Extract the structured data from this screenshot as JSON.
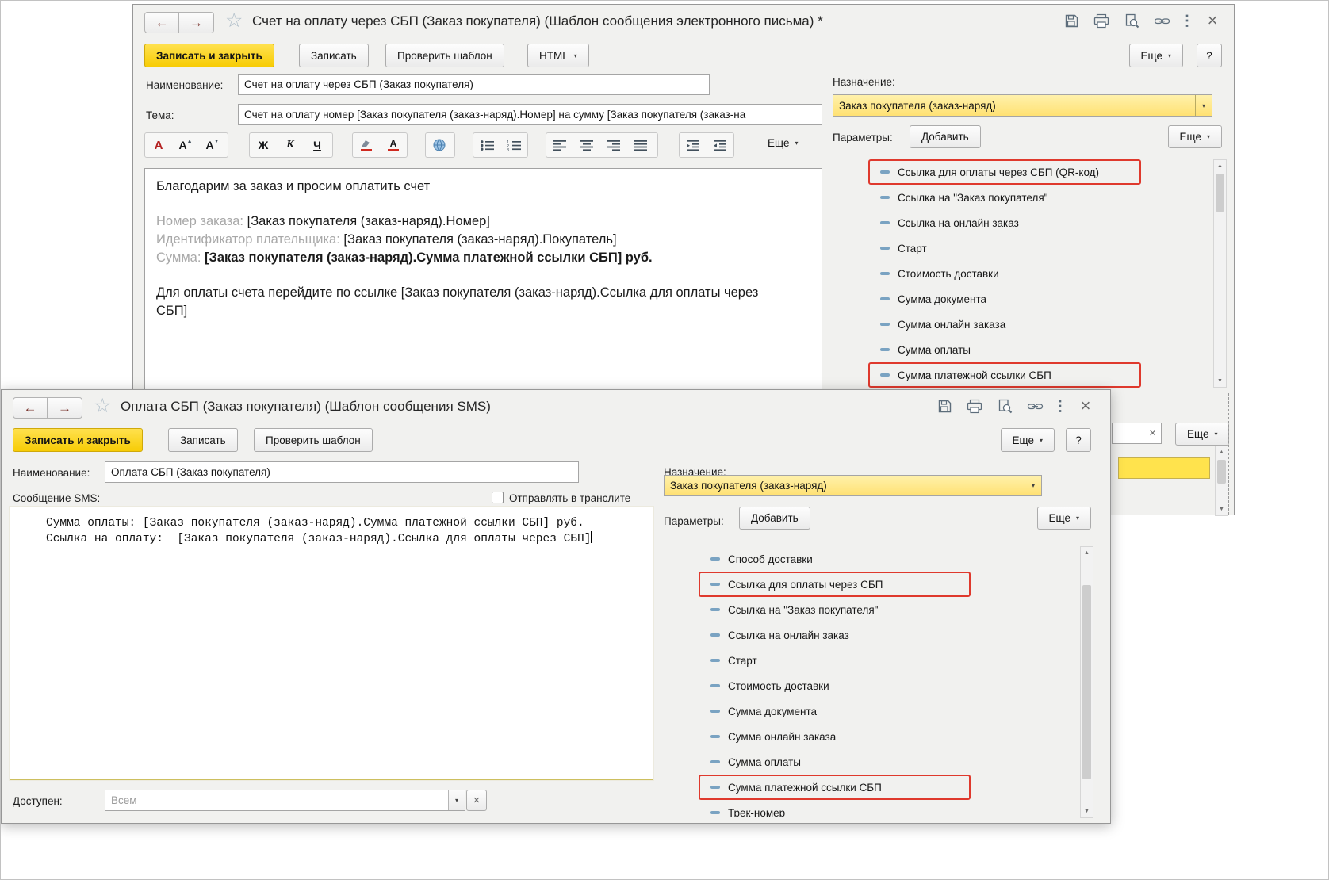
{
  "icons": {
    "back": "←",
    "forward": "→",
    "star": "☆",
    "kebab": "⋮",
    "close": "×",
    "caret": "▾",
    "up": "▲",
    "down": "▼",
    "font_a": "А",
    "clear": "×",
    "help": "?"
  },
  "email_window": {
    "title": "Счет на оплату через СБП (Заказ покупателя) (Шаблон сообщения электронного письма) *",
    "commands": {
      "save_close": "Записать и закрыть",
      "save": "Записать",
      "check": "Проверить шаблон",
      "html": "HTML",
      "more": "Еще",
      "help": "?"
    },
    "name_label": "Наименование:",
    "name_value": "Счет на оплату через СБП (Заказ покупателя)",
    "subject_label": "Тема:",
    "subject_value": "Счет на оплату номер [Заказ покупателя (заказ-наряд).Номер] на сумму [Заказ покупателя (заказ-на",
    "format_toolbar": {
      "bold": "Ж",
      "italic": "К",
      "underline": "Ч",
      "more": "Еще"
    },
    "body": {
      "greeting": "Благодарим за заказ и просим оплатить счет",
      "order_label": "Номер заказа:",
      "order_value": "[Заказ покупателя (заказ-наряд).Номер]",
      "payer_label": "Идентификатор плательщика:",
      "payer_value": "[Заказ покупателя (заказ-наряд).Покупатель]",
      "amount_label": "Сумма:",
      "amount_value": "[Заказ покупателя (заказ-наряд).Сумма платежной ссылки СБП] руб.",
      "pay_link_text": "Для оплаты счета перейдите по ссылке [Заказ покупателя (заказ-наряд).Ссылка для оплаты через СБП]"
    },
    "purpose_label": "Назначение:",
    "purpose_value": "Заказ покупателя (заказ-наряд)",
    "params_label": "Параметры:",
    "add_button": "Добавить",
    "params_more": "Еще",
    "footer_more": "Еще",
    "params": [
      {
        "label": "Ссылка для оплаты через СБП (QR-код)",
        "highlighted": true
      },
      {
        "label": "Ссылка на \"Заказ покупателя\"",
        "highlighted": false
      },
      {
        "label": "Ссылка на онлайн заказ",
        "highlighted": false
      },
      {
        "label": "Старт",
        "highlighted": false
      },
      {
        "label": "Стоимость доставки",
        "highlighted": false
      },
      {
        "label": "Сумма документа",
        "highlighted": false
      },
      {
        "label": "Сумма онлайн заказа",
        "highlighted": false
      },
      {
        "label": "Сумма оплаты",
        "highlighted": false
      },
      {
        "label": "Сумма платежной ссылки СБП",
        "highlighted": true
      }
    ]
  },
  "sms_window": {
    "title": "Оплата СБП (Заказ покупателя) (Шаблон сообщения SMS)",
    "commands": {
      "save_close": "Записать и закрыть",
      "save": "Записать",
      "check": "Проверить шаблон",
      "more": "Еще",
      "help": "?"
    },
    "name_label": "Наименование:",
    "name_value": "Оплата СБП (Заказ покупателя)",
    "message_label": "Сообщение SMS:",
    "translit_label": "Отправлять в транслите",
    "message_lines": [
      "Сумма оплаты: [Заказ покупателя (заказ-наряд).Сумма платежной ссылки СБП] руб.",
      "Ссылка на оплату:  [Заказ покупателя (заказ-наряд).Ссылка для оплаты через СБП]"
    ],
    "available_label": "Доступен:",
    "available_value": "Всем",
    "purpose_label": "Назначение:",
    "purpose_value": "Заказ покупателя (заказ-наряд)",
    "params_label": "Параметры:",
    "add_button": "Добавить",
    "params_more": "Еще",
    "params": [
      {
        "label": "Способ доставки",
        "highlighted": false
      },
      {
        "label": "Ссылка для оплаты через СБП",
        "highlighted": true
      },
      {
        "label": "Ссылка на \"Заказ покупателя\"",
        "highlighted": false
      },
      {
        "label": "Ссылка на онлайн заказ",
        "highlighted": false
      },
      {
        "label": "Старт",
        "highlighted": false
      },
      {
        "label": "Стоимость доставки",
        "highlighted": false
      },
      {
        "label": "Сумма документа",
        "highlighted": false
      },
      {
        "label": "Сумма онлайн заказа",
        "highlighted": false
      },
      {
        "label": "Сумма оплаты",
        "highlighted": false
      },
      {
        "label": "Сумма платежной ссылки СБП",
        "highlighted": true
      },
      {
        "label": "Трек-номер",
        "highlighted": false
      }
    ]
  },
  "colors": {
    "accent_yellow": "#f7cc05",
    "highlight_red": "#df392d",
    "combo_yellow": "#ffe173",
    "param_icon_blue": "#7aa3c2"
  }
}
